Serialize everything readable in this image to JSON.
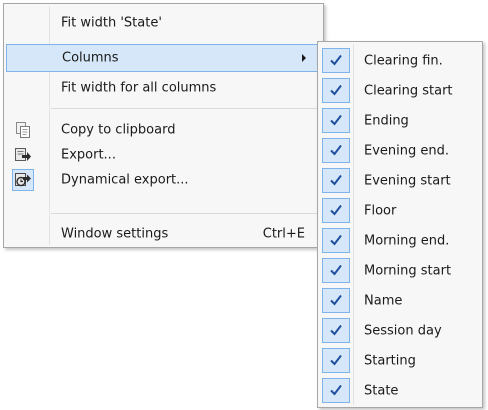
{
  "context_menu": {
    "items": [
      {
        "label": "Fit width 'State'"
      },
      {
        "label": "Columns",
        "has_submenu": true,
        "highlighted": true
      },
      {
        "label": "Fit width for all columns"
      },
      {
        "label": "Copy to clipboard",
        "icon": "copy-icon"
      },
      {
        "label": "Export...",
        "icon": "export-icon"
      },
      {
        "label": "Dynamical export...",
        "icon": "dynamic-export-icon"
      },
      {
        "label": "Window settings",
        "shortcut": "Ctrl+E"
      }
    ]
  },
  "columns_submenu": {
    "items": [
      {
        "label": "Clearing fin.",
        "checked": true
      },
      {
        "label": "Clearing start",
        "checked": true
      },
      {
        "label": "Ending",
        "checked": true
      },
      {
        "label": "Evening end.",
        "checked": true
      },
      {
        "label": "Evening start",
        "checked": true
      },
      {
        "label": "Floor",
        "checked": true
      },
      {
        "label": "Morning end.",
        "checked": true
      },
      {
        "label": "Morning start",
        "checked": true
      },
      {
        "label": "Name",
        "checked": true
      },
      {
        "label": "Session day",
        "checked": true
      },
      {
        "label": "Starting",
        "checked": true
      },
      {
        "label": "State",
        "checked": true
      }
    ]
  },
  "colors": {
    "menu_background": "#f7f7f7",
    "highlight_fill": "#d5e7f8",
    "highlight_border": "#7eb4ea",
    "check_mark": "#1f4f9e"
  }
}
